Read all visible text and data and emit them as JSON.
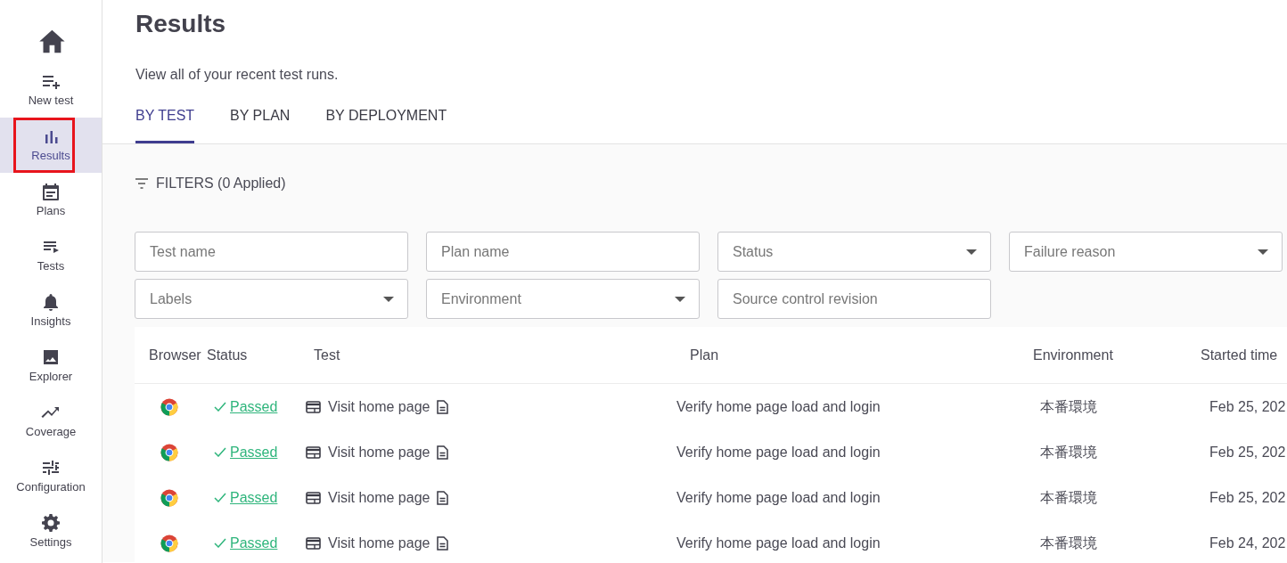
{
  "sidebar": {
    "items": [
      {
        "kind": "home",
        "selected": false,
        "highlighted": false
      },
      {
        "kind": "new-test",
        "label": "New test",
        "selected": false,
        "highlighted": false
      },
      {
        "kind": "results",
        "label": "Results",
        "selected": true,
        "highlighted": true
      },
      {
        "kind": "plans",
        "label": "Plans",
        "selected": false,
        "highlighted": false
      },
      {
        "kind": "tests",
        "label": "Tests",
        "selected": false,
        "highlighted": false
      },
      {
        "kind": "insights",
        "label": "Insights",
        "selected": false,
        "highlighted": false
      },
      {
        "kind": "explorer",
        "label": "Explorer",
        "selected": false,
        "highlighted": false
      },
      {
        "kind": "coverage",
        "label": "Coverage",
        "selected": false,
        "highlighted": false
      },
      {
        "kind": "configuration",
        "label": "Configuration",
        "selected": false,
        "highlighted": false
      },
      {
        "kind": "settings",
        "label": "Settings",
        "selected": false,
        "highlighted": false
      }
    ]
  },
  "page": {
    "title": "Results",
    "subtitle": "View all of your recent test runs."
  },
  "tabs": [
    {
      "label": "BY TEST",
      "selected": true
    },
    {
      "label": "BY PLAN",
      "selected": false
    },
    {
      "label": "BY DEPLOYMENT",
      "selected": false
    }
  ],
  "filters": {
    "label": "FILTERS (0 Applied)",
    "fields": [
      {
        "kind": "text",
        "placeholder": "Test name"
      },
      {
        "kind": "text",
        "placeholder": "Plan name"
      },
      {
        "kind": "select",
        "placeholder": "Status"
      },
      {
        "kind": "select",
        "placeholder": "Failure reason"
      },
      {
        "kind": "select",
        "placeholder": "Labels"
      },
      {
        "kind": "select",
        "placeholder": "Environment"
      },
      {
        "kind": "text",
        "placeholder": "Source control revision"
      }
    ]
  },
  "table": {
    "columns": [
      "Browser",
      "Status",
      "Test",
      "Plan",
      "Environment",
      "Started time"
    ],
    "rows": [
      {
        "status": "Passed",
        "test": "Visit home page",
        "plan": "Verify home page load and login",
        "environment": "本番環境",
        "started_time": "Feb 25, 202"
      },
      {
        "status": "Passed",
        "test": "Visit home page",
        "plan": "Verify home page load and login",
        "environment": "本番環境",
        "started_time": "Feb 25, 202"
      },
      {
        "status": "Passed",
        "test": "Visit home page",
        "plan": "Verify home page load and login",
        "environment": "本番環境",
        "started_time": "Feb 25, 202"
      },
      {
        "status": "Passed",
        "test": "Visit home page",
        "plan": "Verify home page load and login",
        "environment": "本番環境",
        "started_time": "Feb 24, 202"
      }
    ]
  }
}
